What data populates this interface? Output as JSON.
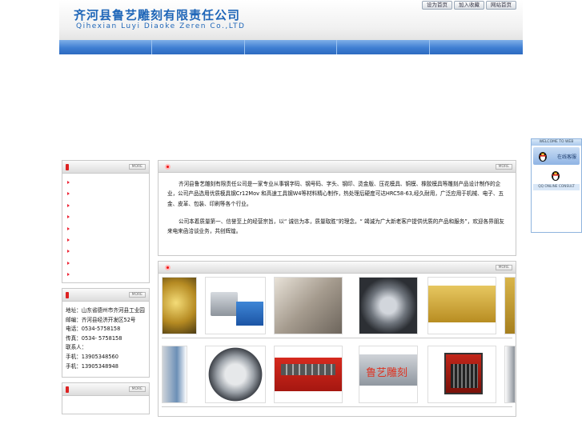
{
  "header": {
    "company_cn": "齐河县鲁艺雕刻有限责任公司",
    "company_en": "Qihexian Luyi Diaoke Zeren Co.,LTD",
    "links": [
      "设为首页",
      "加入收藏",
      "网站首页"
    ]
  },
  "nav": {
    "items": [
      "",
      "",
      "",
      "",
      ""
    ]
  },
  "sidebar": {
    "more_label": "MORE",
    "categories": [
      "",
      "",
      "",
      "",
      "",
      "",
      "",
      "",
      "",
      "",
      ""
    ],
    "contact": [
      "地址：山东省德州市齐河县工业园",
      "邮编：齐河县经济开发区52号",
      "电话：0534-5758158",
      "传真：0534- 5758158",
      "联系人：",
      "手机：13905348560",
      "手机：13905348948"
    ]
  },
  "about": {
    "more_label": "MORE",
    "paragraphs": [
      "齐河县鲁艺雕刻有限责任公司是一家专业从事钢字码、钢号码、字头、钢印、烫金版、压花模具、铜模、橡胶模具等雕刻产品设计制作的企业，公司产品选用优质模具钢Cr12Mov 和高速工具钢W4等材料精心制作，热处理后硬度可达HRC58-63,经久耐用，广泛应用于机械、电子、五金、皮革、包装、印刷等各个行业。",
      "公司本着质量第一、信誉至上的经营宗旨，以“ 诚信为本，质量取胜”的理念，“ 竭诚为广大新老客户提供优质的产品和服务”，欢迎各界朋友来电来函洽谈业务，共创辉煌。"
    ]
  },
  "products": {
    "more_label": "MORE",
    "watermark": "鲁艺雕刻"
  },
  "qq": {
    "header": "WELCOME TO WEB",
    "label": "在线客服",
    "footer": "QQ ONLINE CONSULT"
  }
}
